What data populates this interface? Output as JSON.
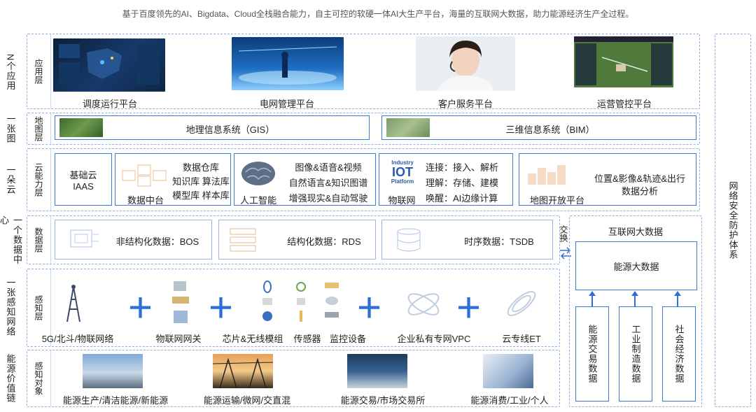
{
  "subtitle": "基于百度领先的AI、Bigdata、Cloud全栈融合能力，自主可控的软硬一体AI大生产平台，海量的互联网大数据，助力能源经济生产全过程。",
  "left_labels": {
    "apps": "N个应用",
    "map": "一张图",
    "cloud": "一朵云",
    "data": "一个数据中心",
    "perception": "一张感知网络",
    "value": "能源价值链"
  },
  "tags": {
    "apps": "应用层",
    "map": "地图层",
    "cloud": "云能力层",
    "data": "数据层",
    "perception": "感知层",
    "object": "感知对象"
  },
  "apps": [
    "调度运行平台",
    "电网管理平台",
    "客户服务平台",
    "运营管控平台"
  ],
  "map": {
    "gis": "地理信息系统（GIS）",
    "bim": "三维信息系统（BIM）"
  },
  "cloud": {
    "iaas": [
      "基础云",
      "IAAS"
    ],
    "datacenter": {
      "name": "数据中台",
      "lines": [
        "数据仓库",
        "知识库 算法库",
        "模型库 样本库"
      ]
    },
    "ai": {
      "name": "人工智能",
      "lines": [
        "图像&语音&视频",
        "自然语言&知识图谱",
        "增强现实&自动驾驶"
      ]
    },
    "iot": {
      "name": "物联网",
      "logo": [
        "Industry",
        "IOT",
        "Platform"
      ],
      "lines": [
        "连接：接入、解析",
        "理解：存储、建模",
        "唤醒：AI边缘计算"
      ]
    },
    "mapopen": {
      "name": "地图开放平台",
      "lines": [
        "位置&影像&轨迹&出行",
        "数据分析"
      ]
    }
  },
  "data": {
    "bos": "非结构化数据：BOS",
    "rds": "结构化数据：RDS",
    "tsdb": "时序数据：TSDB",
    "exchange": "交换"
  },
  "perception": {
    "items": [
      "5G/北斗/物联网络",
      "物联网网关",
      "芯片&无线模组",
      "传感器",
      "监控设备",
      "企业私有专网VPC",
      "云专线ET"
    ]
  },
  "value_chain": [
    "能源生产/清洁能源/新能源",
    "能源运输/微网/交直混",
    "能源交易/市场交易所",
    "能源消费/工业/个人"
  ],
  "internet": {
    "title": "互联网大数据",
    "energy": "能源大数据",
    "sources": [
      "能源交易数据",
      "工业制造数据",
      "社会经济数据"
    ]
  },
  "security": "网络安全防护体系",
  "colors": {
    "accent": "#2e6fd6",
    "border": "#3a7bd5",
    "dashed": "#8fb0e0"
  }
}
